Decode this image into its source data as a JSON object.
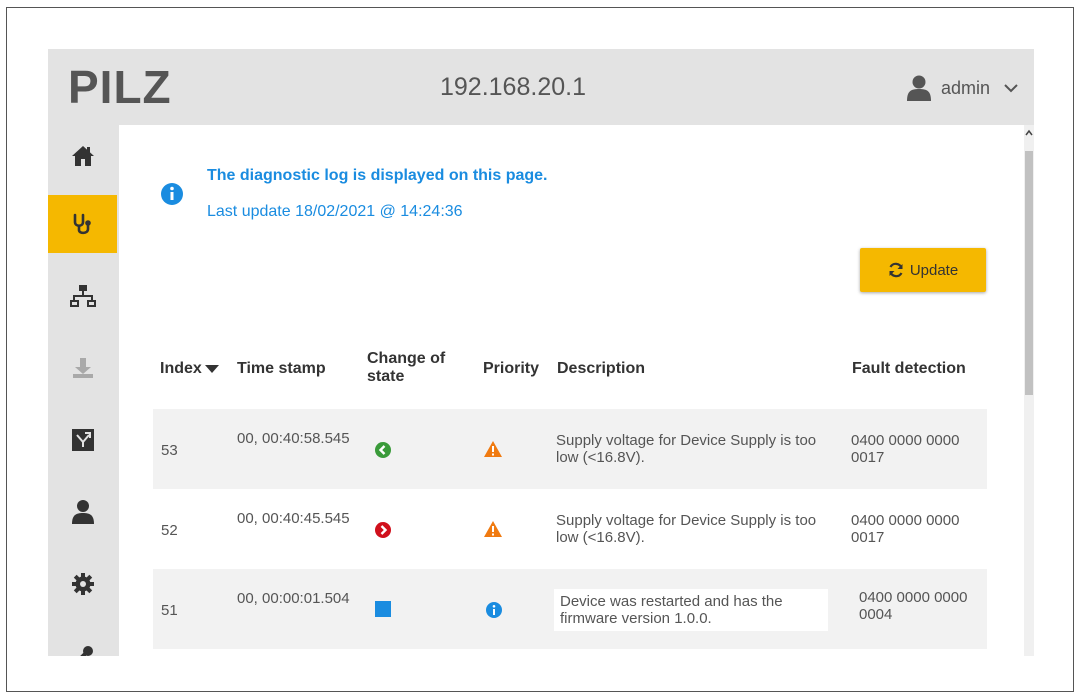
{
  "header": {
    "logo": "PILZ",
    "ip_address": "192.168.20.1",
    "user": "admin"
  },
  "sidebar": {
    "items": [
      {
        "name": "home",
        "icon": "home-icon",
        "active": false
      },
      {
        "name": "diagnostics",
        "icon": "stethoscope-icon",
        "active": true
      },
      {
        "name": "network",
        "icon": "network-icon",
        "active": false
      },
      {
        "name": "download",
        "icon": "download-icon",
        "active": false
      },
      {
        "name": "topology",
        "icon": "topology-icon",
        "active": false
      },
      {
        "name": "user",
        "icon": "user-icon",
        "active": false
      },
      {
        "name": "settings",
        "icon": "gear-icon",
        "active": false
      },
      {
        "name": "tools",
        "icon": "wrench-icon",
        "active": false
      }
    ]
  },
  "info": {
    "title": "The diagnostic log is displayed on this page.",
    "last_update": "Last update 18/02/2021 @ 14:24:36"
  },
  "update_button": {
    "label": "Update",
    "icon": "refresh-icon"
  },
  "table": {
    "columns": {
      "index": "Index",
      "timestamp": "Time stamp",
      "change_of_state": "Change of state",
      "priority": "Priority",
      "description": "Description",
      "fault_detection": "Fault detection"
    },
    "rows": [
      {
        "index": "53",
        "timestamp": "00, 00:40:58.545",
        "change_icon": "arrow-left-circle-icon",
        "change_color": "#3a9b3a",
        "priority_icon": "warning-icon",
        "priority_color": "#f07a10",
        "description": "Supply voltage for Device Supply is too low (<16.8V).",
        "fault_detection": "0400 0000 0000 0017"
      },
      {
        "index": "52",
        "timestamp": "00, 00:40:45.545",
        "change_icon": "arrow-right-circle-icon",
        "change_color": "#d0101c",
        "priority_icon": "warning-icon",
        "priority_color": "#f07a10",
        "description": "Supply voltage for Device Supply is too low (<16.8V).",
        "fault_detection": "0400 0000 0000 0017"
      },
      {
        "index": "51",
        "timestamp": "00, 00:00:01.504",
        "change_icon": "square-icon",
        "change_color": "#1a8ce0",
        "priority_icon": "info-icon",
        "priority_color": "#1a8ce0",
        "description": "Device was restarted and has the firmware version 1.0.0.",
        "fault_detection": "0400 0000 0000 0004"
      }
    ]
  },
  "colors": {
    "accent": "#f5b800",
    "info_blue": "#1a8ce0",
    "header_bg": "#e3e3e3"
  }
}
